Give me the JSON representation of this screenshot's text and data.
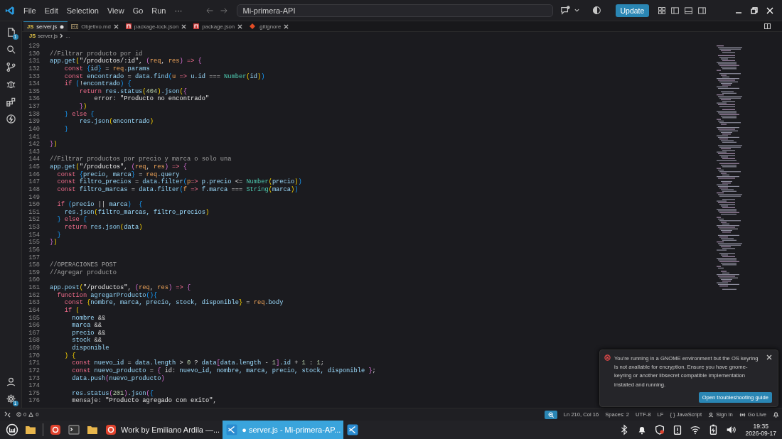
{
  "title_bar": {
    "menu": [
      "File",
      "Edit",
      "Selection",
      "View",
      "Go",
      "Run",
      "···"
    ],
    "command_center": "Mi-primera-API",
    "update_button": "Update"
  },
  "activity_bar": {
    "top": [
      {
        "kind": "files",
        "badge": "1",
        "selected": false
      },
      {
        "kind": "search",
        "selected": false
      },
      {
        "kind": "scm",
        "selected": false
      },
      {
        "kind": "debug",
        "selected": false
      },
      {
        "kind": "extensions",
        "selected": false
      },
      {
        "kind": "bolt",
        "selected": false
      }
    ],
    "bottom": [
      {
        "kind": "account"
      },
      {
        "kind": "gear",
        "badge": "1"
      }
    ]
  },
  "tabs": [
    {
      "kind": "js",
      "icon_text": "JS",
      "label": "server.js",
      "selected": true,
      "modified": true
    },
    {
      "kind": "md",
      "label": "Objetivo.md",
      "selected": false,
      "modified": false
    },
    {
      "kind": "npm",
      "label": "package-lock.json",
      "selected": false,
      "modified": false
    },
    {
      "kind": "npm",
      "label": "package.json",
      "selected": false,
      "modified": false
    },
    {
      "kind": "git",
      "label": ".gitignore",
      "selected": false,
      "modified": false
    }
  ],
  "breadcrumb": {
    "icon_text": "JS",
    "file": "server.js",
    "rest": "..."
  },
  "editor": {
    "lines": [
      {
        "number": "129"
      },
      {
        "number": "130",
        "tokens": [
          {
            "kind": "com",
            "text": "//Filtrar producto por id"
          }
        ]
      },
      {
        "number": "131",
        "tokens": [
          {
            "kind": "fn",
            "text": "app.get"
          },
          {
            "kind": "b1",
            "text": "("
          },
          {
            "kind": "str",
            "text": "\"/productos/:id\""
          },
          {
            "kind": "pl",
            "text": ", "
          },
          {
            "kind": "b2",
            "text": "("
          },
          {
            "kind": "par",
            "text": "req"
          },
          {
            "kind": "pl",
            "text": ", "
          },
          {
            "kind": "par",
            "text": "res"
          },
          {
            "kind": "b2",
            "text": ")"
          },
          {
            "kind": "kw",
            "text": " => "
          },
          {
            "kind": "b2",
            "text": "{"
          }
        ]
      },
      {
        "number": "132",
        "tokens": [
          {
            "kind": "kw",
            "text": "    const "
          },
          {
            "kind": "b3",
            "text": "{"
          },
          {
            "kind": "var",
            "text": "id"
          },
          {
            "kind": "b3",
            "text": "}"
          },
          {
            "kind": "pl",
            "text": " = "
          },
          {
            "kind": "par",
            "text": "req"
          },
          {
            "kind": "var",
            "text": ".params"
          }
        ]
      },
      {
        "number": "133",
        "tokens": [
          {
            "kind": "kw",
            "text": "    const "
          },
          {
            "kind": "var",
            "text": "encontrado"
          },
          {
            "kind": "pl",
            "text": " = "
          },
          {
            "kind": "fn",
            "text": "data.find"
          },
          {
            "kind": "b3",
            "text": "("
          },
          {
            "kind": "par",
            "text": "u"
          },
          {
            "kind": "kw",
            "text": " => "
          },
          {
            "kind": "var",
            "text": "u.id"
          },
          {
            "kind": "pl",
            "text": " === "
          },
          {
            "kind": "cls",
            "text": "Number"
          },
          {
            "kind": "b1",
            "text": "("
          },
          {
            "kind": "var",
            "text": "id"
          },
          {
            "kind": "b1",
            "text": ")"
          },
          {
            "kind": "b3",
            "text": ")"
          }
        ]
      },
      {
        "number": "134",
        "tokens": [
          {
            "kind": "kw",
            "text": "    if "
          },
          {
            "kind": "b3",
            "text": "("
          },
          {
            "kind": "pl",
            "text": "!"
          },
          {
            "kind": "var",
            "text": "encontrado"
          },
          {
            "kind": "b3",
            "text": ")"
          },
          {
            "kind": "b3",
            "text": " {"
          }
        ]
      },
      {
        "number": "135",
        "tokens": [
          {
            "kind": "kw",
            "text": "        return "
          },
          {
            "kind": "fn",
            "text": "res.status"
          },
          {
            "kind": "b1",
            "text": "("
          },
          {
            "kind": "num",
            "text": "404"
          },
          {
            "kind": "b1",
            "text": ")"
          },
          {
            "kind": "fn",
            "text": ".json"
          },
          {
            "kind": "b1",
            "text": "("
          },
          {
            "kind": "b2",
            "text": "{"
          }
        ]
      },
      {
        "number": "136",
        "tokens": [
          {
            "kind": "pl",
            "text": "            error: "
          },
          {
            "kind": "str",
            "text": "\"Producto no encontrado\""
          }
        ]
      },
      {
        "number": "137",
        "tokens": [
          {
            "kind": "b2",
            "text": "        }"
          },
          {
            "kind": "b1",
            "text": ")"
          }
        ]
      },
      {
        "number": "138",
        "tokens": [
          {
            "kind": "b3",
            "text": "    }"
          },
          {
            "kind": "kw",
            "text": " else "
          },
          {
            "kind": "b3",
            "text": "{"
          }
        ]
      },
      {
        "number": "139",
        "tokens": [
          {
            "kind": "fn",
            "text": "        res.json"
          },
          {
            "kind": "b1",
            "text": "("
          },
          {
            "kind": "var",
            "text": "encontrado"
          },
          {
            "kind": "b1",
            "text": ")"
          }
        ]
      },
      {
        "number": "140",
        "tokens": [
          {
            "kind": "b3",
            "text": "    }"
          }
        ]
      },
      {
        "number": "141"
      },
      {
        "number": "142",
        "tokens": [
          {
            "kind": "b2",
            "text": "}"
          },
          {
            "kind": "b1",
            "text": ")"
          }
        ]
      },
      {
        "number": "143"
      },
      {
        "number": "144",
        "tokens": [
          {
            "kind": "com",
            "text": "//Filtrar productos por precio y marca o solo una"
          }
        ]
      },
      {
        "number": "145",
        "tokens": [
          {
            "kind": "fn",
            "text": "app.get"
          },
          {
            "kind": "b1",
            "text": "("
          },
          {
            "kind": "str",
            "text": "\"/productos\""
          },
          {
            "kind": "pl",
            "text": ", "
          },
          {
            "kind": "b2",
            "text": "("
          },
          {
            "kind": "par",
            "text": "req"
          },
          {
            "kind": "pl",
            "text": ", "
          },
          {
            "kind": "par",
            "text": "res"
          },
          {
            "kind": "b2",
            "text": ")"
          },
          {
            "kind": "kw",
            "text": " => "
          },
          {
            "kind": "b2",
            "text": "{"
          }
        ]
      },
      {
        "number": "146",
        "tokens": [
          {
            "kind": "kw",
            "text": "  const "
          },
          {
            "kind": "b3",
            "text": "{"
          },
          {
            "kind": "var",
            "text": "precio, marca"
          },
          {
            "kind": "b3",
            "text": "}"
          },
          {
            "kind": "pl",
            "text": " = "
          },
          {
            "kind": "par",
            "text": "req"
          },
          {
            "kind": "var",
            "text": ".query"
          }
        ]
      },
      {
        "number": "147",
        "tokens": [
          {
            "kind": "kw",
            "text": "  const "
          },
          {
            "kind": "var",
            "text": "filtro_precios"
          },
          {
            "kind": "pl",
            "text": " = "
          },
          {
            "kind": "fn",
            "text": "data.filter"
          },
          {
            "kind": "b3",
            "text": "("
          },
          {
            "kind": "par",
            "text": "p"
          },
          {
            "kind": "kw",
            "text": "=> "
          },
          {
            "kind": "var",
            "text": "p.precio"
          },
          {
            "kind": "pl",
            "text": " <= "
          },
          {
            "kind": "cls",
            "text": "Number"
          },
          {
            "kind": "b1",
            "text": "("
          },
          {
            "kind": "var",
            "text": "precio"
          },
          {
            "kind": "b1",
            "text": ")"
          },
          {
            "kind": "b3",
            "text": ")"
          }
        ]
      },
      {
        "number": "148",
        "tokens": [
          {
            "kind": "kw",
            "text": "  const "
          },
          {
            "kind": "var",
            "text": "filtro_marcas"
          },
          {
            "kind": "pl",
            "text": " = "
          },
          {
            "kind": "fn",
            "text": "data.filter"
          },
          {
            "kind": "b3",
            "text": "("
          },
          {
            "kind": "par",
            "text": "f"
          },
          {
            "kind": "kw",
            "text": " => "
          },
          {
            "kind": "var",
            "text": "f.marca"
          },
          {
            "kind": "pl",
            "text": " === "
          },
          {
            "kind": "cls",
            "text": "String"
          },
          {
            "kind": "b1",
            "text": "("
          },
          {
            "kind": "var",
            "text": "marca"
          },
          {
            "kind": "b1",
            "text": ")"
          },
          {
            "kind": "b3",
            "text": ")"
          }
        ]
      },
      {
        "number": "149"
      },
      {
        "number": "150",
        "tokens": [
          {
            "kind": "kw",
            "text": "  if "
          },
          {
            "kind": "b3",
            "text": "("
          },
          {
            "kind": "var",
            "text": "precio"
          },
          {
            "kind": "pl",
            "text": " || "
          },
          {
            "kind": "var",
            "text": "marca"
          },
          {
            "kind": "b3",
            "text": ")"
          },
          {
            "kind": "b3",
            "text": "  {"
          }
        ]
      },
      {
        "number": "151",
        "tokens": [
          {
            "kind": "fn",
            "text": "    res.json"
          },
          {
            "kind": "b1",
            "text": "("
          },
          {
            "kind": "var",
            "text": "filtro_marcas, filtro_precios"
          },
          {
            "kind": "b1",
            "text": ")"
          }
        ]
      },
      {
        "number": "152",
        "tokens": [
          {
            "kind": "b3",
            "text": "  }"
          },
          {
            "kind": "kw",
            "text": " else "
          },
          {
            "kind": "b3",
            "text": "{"
          }
        ]
      },
      {
        "number": "153",
        "tokens": [
          {
            "kind": "kw",
            "text": "    return "
          },
          {
            "kind": "fn",
            "text": "res.json"
          },
          {
            "kind": "b1",
            "text": "("
          },
          {
            "kind": "var",
            "text": "data"
          },
          {
            "kind": "b1",
            "text": ")"
          }
        ]
      },
      {
        "number": "154",
        "tokens": [
          {
            "kind": "b3",
            "text": "  }"
          }
        ]
      },
      {
        "number": "155",
        "tokens": [
          {
            "kind": "b2",
            "text": "}"
          },
          {
            "kind": "b1",
            "text": ")"
          }
        ]
      },
      {
        "number": "156"
      },
      {
        "number": "157"
      },
      {
        "number": "158",
        "tokens": [
          {
            "kind": "com",
            "text": "//OPERACIONES POST"
          }
        ]
      },
      {
        "number": "159",
        "tokens": [
          {
            "kind": "com",
            "text": "//Agregar producto"
          }
        ]
      },
      {
        "number": "160"
      },
      {
        "number": "161",
        "tokens": [
          {
            "kind": "fn",
            "text": "app.post"
          },
          {
            "kind": "b1",
            "text": "("
          },
          {
            "kind": "str",
            "text": "\"/productos\""
          },
          {
            "kind": "pl",
            "text": ", "
          },
          {
            "kind": "b2",
            "text": "("
          },
          {
            "kind": "par",
            "text": "req"
          },
          {
            "kind": "pl",
            "text": ", "
          },
          {
            "kind": "par",
            "text": "res"
          },
          {
            "kind": "b2",
            "text": ")"
          },
          {
            "kind": "kw",
            "text": " => "
          },
          {
            "kind": "b2",
            "text": "{"
          }
        ]
      },
      {
        "number": "162",
        "tokens": [
          {
            "kind": "kw",
            "text": "  function "
          },
          {
            "kind": "fn",
            "text": "agregarProducto"
          },
          {
            "kind": "b3",
            "text": "(){"
          }
        ]
      },
      {
        "number": "163",
        "tokens": [
          {
            "kind": "kw",
            "text": "    const "
          },
          {
            "kind": "b1",
            "text": "{"
          },
          {
            "kind": "var",
            "text": "nombre, marca, precio, stock, disponible"
          },
          {
            "kind": "b1",
            "text": "}"
          },
          {
            "kind": "pl",
            "text": " = "
          },
          {
            "kind": "par",
            "text": "req"
          },
          {
            "kind": "var",
            "text": ".body"
          }
        ]
      },
      {
        "number": "164",
        "tokens": [
          {
            "kind": "kw",
            "text": "    if "
          },
          {
            "kind": "b1",
            "text": "("
          }
        ]
      },
      {
        "number": "165",
        "tokens": [
          {
            "kind": "var",
            "text": "      nombre"
          },
          {
            "kind": "pl",
            "text": " &&"
          }
        ]
      },
      {
        "number": "166",
        "tokens": [
          {
            "kind": "var",
            "text": "      marca"
          },
          {
            "kind": "pl",
            "text": " &&"
          }
        ]
      },
      {
        "number": "167",
        "tokens": [
          {
            "kind": "var",
            "text": "      precio"
          },
          {
            "kind": "pl",
            "text": " &&"
          }
        ]
      },
      {
        "number": "168",
        "tokens": [
          {
            "kind": "var",
            "text": "      stock"
          },
          {
            "kind": "pl",
            "text": " &&"
          }
        ]
      },
      {
        "number": "169",
        "tokens": [
          {
            "kind": "var",
            "text": "      disponible"
          }
        ]
      },
      {
        "number": "170",
        "tokens": [
          {
            "kind": "b1",
            "text": "    )"
          },
          {
            "kind": "b1",
            "text": " {"
          }
        ]
      },
      {
        "number": "171",
        "tokens": [
          {
            "kind": "kw",
            "text": "      const "
          },
          {
            "kind": "var",
            "text": "nuevo_id"
          },
          {
            "kind": "pl",
            "text": " = "
          },
          {
            "kind": "var",
            "text": "data.length"
          },
          {
            "kind": "pl",
            "text": " > "
          },
          {
            "kind": "num",
            "text": "0"
          },
          {
            "kind": "pl",
            "text": " ? "
          },
          {
            "kind": "var",
            "text": "data"
          },
          {
            "kind": "b2",
            "text": "["
          },
          {
            "kind": "var",
            "text": "data.length"
          },
          {
            "kind": "pl",
            "text": " - "
          },
          {
            "kind": "num",
            "text": "1"
          },
          {
            "kind": "b2",
            "text": "]"
          },
          {
            "kind": "var",
            "text": ".id"
          },
          {
            "kind": "pl",
            "text": " + "
          },
          {
            "kind": "num",
            "text": "1"
          },
          {
            "kind": "pl",
            "text": " : "
          },
          {
            "kind": "num",
            "text": "1"
          },
          {
            "kind": "pl",
            "text": ";"
          }
        ]
      },
      {
        "number": "172",
        "tokens": [
          {
            "kind": "kw",
            "text": "      const "
          },
          {
            "kind": "var",
            "text": "nuevo_producto"
          },
          {
            "kind": "pl",
            "text": " = "
          },
          {
            "kind": "b2",
            "text": "{"
          },
          {
            "kind": "pl",
            "text": " id: "
          },
          {
            "kind": "var",
            "text": "nuevo_id, nombre, marca, precio, stock, disponible"
          },
          {
            "kind": "b2",
            "text": " }"
          },
          {
            "kind": "pl",
            "text": ";"
          }
        ]
      },
      {
        "number": "173",
        "tokens": [
          {
            "kind": "fn",
            "text": "      data.push"
          },
          {
            "kind": "b2",
            "text": "("
          },
          {
            "kind": "var",
            "text": "nuevo_producto"
          },
          {
            "kind": "b2",
            "text": ")"
          }
        ]
      },
      {
        "number": "174"
      },
      {
        "number": "175",
        "tokens": [
          {
            "kind": "fn",
            "text": "      res.status"
          },
          {
            "kind": "b2",
            "text": "("
          },
          {
            "kind": "num",
            "text": "201"
          },
          {
            "kind": "b2",
            "text": ")"
          },
          {
            "kind": "fn",
            "text": ".json"
          },
          {
            "kind": "b2",
            "text": "("
          },
          {
            "kind": "b3",
            "text": "{"
          }
        ]
      },
      {
        "number": "176",
        "tokens": [
          {
            "kind": "pl",
            "text": "      mensaje: "
          },
          {
            "kind": "str",
            "text": "\"Producto agregado con exito\""
          },
          {
            "kind": "pl",
            "text": ","
          }
        ]
      }
    ]
  },
  "notification": {
    "message": "You're running in a GNOME environment but the OS keyring is not available for encryption. Ensure you have gnome-keyring or another libsecret compatible implementation installed and running.",
    "button": "Open troubleshooting guide"
  },
  "status_bar": {
    "errors": "0",
    "warnings": "0",
    "items": [
      {
        "kind": "zoom"
      },
      {
        "kind": "plain",
        "text": "Ln 210, Col 16"
      },
      {
        "kind": "plain",
        "text": "Spaces: 2"
      },
      {
        "kind": "plain",
        "text": "UTF-8"
      },
      {
        "kind": "plain",
        "text": "LF"
      },
      {
        "kind": "language",
        "braces": "{ }",
        "text": "JavaScript"
      },
      {
        "kind": "account",
        "text": "Sign In"
      },
      {
        "kind": "live",
        "text": "Go Live"
      },
      {
        "kind": "bell"
      }
    ]
  },
  "taskbar": {
    "items": [
      {
        "kind": "mint",
        "selected": false
      },
      {
        "kind": "folder",
        "selected": false
      },
      {
        "kind": "divider",
        "selected": false
      },
      {
        "kind": "browser",
        "selected": false
      },
      {
        "kind": "terminal",
        "selected": false
      },
      {
        "kind": "folder",
        "selected": false
      },
      {
        "kind": "browser",
        "text": "Work by Emiliano Ardila —...",
        "selected": false
      },
      {
        "kind": "vscode",
        "text": "● server.js - Mi-primera-AP...",
        "selected": true
      },
      {
        "kind": "vscode",
        "selected": false
      }
    ],
    "tray": [
      {
        "kind": "bluetooth"
      },
      {
        "kind": "bell"
      },
      {
        "kind": "shield"
      },
      {
        "kind": "clipboard"
      },
      {
        "kind": "wifi"
      },
      {
        "kind": "battery"
      },
      {
        "kind": "volume"
      }
    ],
    "time": "19:35",
    "date": "2026-09-17"
  }
}
